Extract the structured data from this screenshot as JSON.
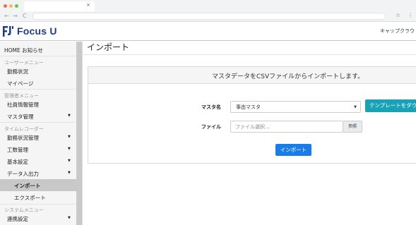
{
  "browser": {
    "dots": [
      "#ec6a5e",
      "#f4bf4f",
      "#61c554"
    ],
    "tab_close": "×",
    "back": "←",
    "forward": "→",
    "reload": "C",
    "star": "☆",
    "menu": "⋮"
  },
  "app": {
    "logo_icon": "focus-u-mark",
    "brand": "Focus U",
    "brand_color": "#1b3f86",
    "company": "キャップクラウド"
  },
  "sidebar": {
    "home": "HOME お知らせ",
    "sections": [
      {
        "header": "ユーザーメニュー",
        "items": [
          "勤務状況",
          "マイページ"
        ]
      },
      {
        "header": "管理者メニュー",
        "items": [
          "社員情報管理",
          "マスタ管理"
        ]
      },
      {
        "header": "タイムレコーダー",
        "items": [
          "勤務状況管理",
          "工数管理",
          "基本設定",
          "データ入出力"
        ]
      },
      {
        "header": "システムメニュー",
        "items": [
          "連携設定"
        ]
      }
    ],
    "sub_items": [
      "インポート",
      "エクスポート"
    ],
    "caret": "▼"
  },
  "main": {
    "title": "インポート",
    "panel_heading": "マスタデータをCSVファイルからインポートします。",
    "master_label": "マスタ名",
    "master_value": "事由マスタ",
    "select_arrow": "▼",
    "template_button": "テンプレートをダウンロード",
    "file_label": "ファイル",
    "file_placeholder": "ファイル選択...",
    "browse_button": "参照",
    "import_button": "インポート",
    "colors": {
      "primary": "#1a7ce6",
      "info": "#17a2b8"
    }
  }
}
